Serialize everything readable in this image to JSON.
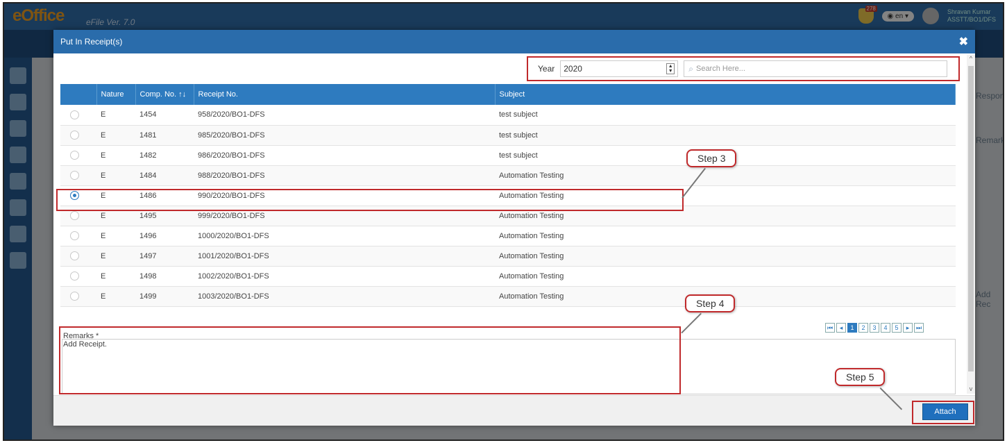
{
  "app": {
    "logo": "eOffice",
    "logo_sub": "eFile Ver. 7.0",
    "notif_count": "278",
    "lang": "en",
    "user_name": "Shravan Kumar",
    "user_role": "ASSTT/BO1/DFS"
  },
  "background": {
    "right_label_1": "Respond",
    "right_label_2": "Remark",
    "right_label_3": "Add Rec"
  },
  "modal": {
    "title": "Put In Receipt(s)",
    "close_icon": "close-icon",
    "year_label": "Year",
    "year_value": "2020",
    "search_placeholder": "Search Here..."
  },
  "table": {
    "headers": [
      "",
      "Nature",
      "Comp. No. ↑↓",
      "Receipt No.",
      "Subject"
    ],
    "rows": [
      {
        "selected": false,
        "nature": "E",
        "comp_no": "1454",
        "receipt_no": "958/2020/BO1-DFS",
        "subject": "test subject"
      },
      {
        "selected": false,
        "nature": "E",
        "comp_no": "1481",
        "receipt_no": "985/2020/BO1-DFS",
        "subject": "test subject"
      },
      {
        "selected": false,
        "nature": "E",
        "comp_no": "1482",
        "receipt_no": "986/2020/BO1-DFS",
        "subject": "test subject"
      },
      {
        "selected": false,
        "nature": "E",
        "comp_no": "1484",
        "receipt_no": "988/2020/BO1-DFS",
        "subject": "Automation Testing"
      },
      {
        "selected": true,
        "nature": "E",
        "comp_no": "1486",
        "receipt_no": "990/2020/BO1-DFS",
        "subject": "Automation Testing"
      },
      {
        "selected": false,
        "nature": "E",
        "comp_no": "1495",
        "receipt_no": "999/2020/BO1-DFS",
        "subject": "Automation Testing"
      },
      {
        "selected": false,
        "nature": "E",
        "comp_no": "1496",
        "receipt_no": "1000/2020/BO1-DFS",
        "subject": "Automation Testing"
      },
      {
        "selected": false,
        "nature": "E",
        "comp_no": "1497",
        "receipt_no": "1001/2020/BO1-DFS",
        "subject": "Automation Testing"
      },
      {
        "selected": false,
        "nature": "E",
        "comp_no": "1498",
        "receipt_no": "1002/2020/BO1-DFS",
        "subject": "Automation Testing"
      },
      {
        "selected": false,
        "nature": "E",
        "comp_no": "1499",
        "receipt_no": "1003/2020/BO1-DFS",
        "subject": "Automation Testing"
      }
    ]
  },
  "pager": {
    "pages": [
      "1",
      "2",
      "3",
      "4",
      "5"
    ],
    "current": "1"
  },
  "remarks": {
    "label": "Remarks *",
    "value": "Add Receipt."
  },
  "buttons": {
    "attach": "Attach"
  },
  "callouts": {
    "step3": "Step 3",
    "step4": "Step 4",
    "step5": "Step 5"
  },
  "colors": {
    "header_blue": "#2a6cab",
    "table_header": "#2e7bbf",
    "highlight_red": "#c0292b"
  }
}
